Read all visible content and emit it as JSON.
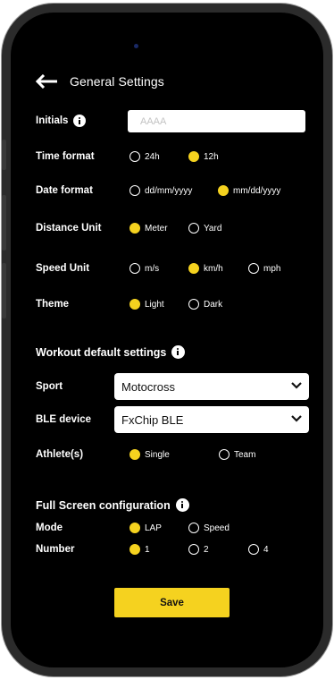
{
  "header": {
    "title": "General Settings"
  },
  "initials": {
    "label": "Initials",
    "placeholder": "AAAA"
  },
  "time_format": {
    "label": "Time format",
    "options": [
      "24h",
      "12h"
    ],
    "selected": "12h"
  },
  "date_format": {
    "label": "Date format",
    "options": [
      "dd/mm/yyyy",
      "mm/dd/yyyy"
    ],
    "selected": "mm/dd/yyyy"
  },
  "distance_unit": {
    "label": "Distance Unit",
    "options": [
      "Meter",
      "Yard"
    ],
    "selected": "Meter"
  },
  "speed_unit": {
    "label": "Speed Unit",
    "options": [
      "m/s",
      "km/h",
      "mph"
    ],
    "selected": "km/h"
  },
  "theme": {
    "label": "Theme",
    "options": [
      "Light",
      "Dark"
    ],
    "selected": "Light"
  },
  "workout": {
    "title": "Workout default settings",
    "sport": {
      "label": "Sport",
      "value": "Motocross"
    },
    "ble": {
      "label": "BLE device",
      "value": "FxChip BLE"
    },
    "athletes": {
      "label": "Athlete(s)",
      "options": [
        "Single",
        "Team"
      ],
      "selected": "Single"
    }
  },
  "fullscreen": {
    "title": "Full Screen configuration",
    "mode": {
      "label": "Mode",
      "options": [
        "LAP",
        "Speed"
      ],
      "selected": "LAP"
    },
    "number": {
      "label": "Number",
      "options": [
        "1",
        "2",
        "4"
      ],
      "selected": "1"
    }
  },
  "save_label": "Save",
  "colors": {
    "accent": "#f5d21f",
    "background": "#000000",
    "text": "#ffffff"
  }
}
